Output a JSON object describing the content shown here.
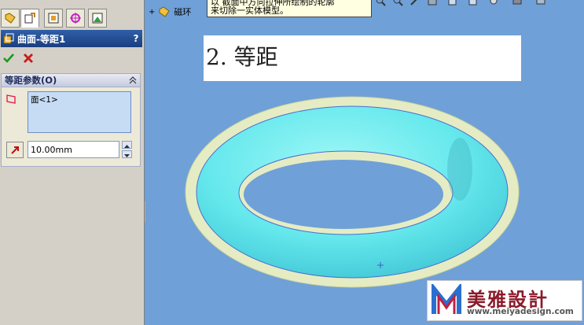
{
  "property_manager": {
    "tabs": [
      {
        "name": "feature-manager-tab",
        "icon": "feature-tree-icon"
      },
      {
        "name": "property-manager-tab",
        "icon": "property-manager-icon"
      },
      {
        "name": "configuration-manager-tab",
        "icon": "configuration-icon"
      },
      {
        "name": "dimxpert-tab",
        "icon": "crosshair-icon"
      },
      {
        "name": "display-manager-tab",
        "icon": "display-icon"
      }
    ],
    "title": "曲面-等距1",
    "help": "?",
    "group": {
      "title": "等距参数(O)",
      "face_list": [
        "面<1>"
      ],
      "offset_value": "10.00mm"
    }
  },
  "viewport": {
    "tree_node_label": "磁环",
    "tooltip_lines": [
      "以   截面中方向拉伸所绘制的轮廓",
      "来切除一实体模型。"
    ],
    "label": "2. 等距"
  },
  "watermark": {
    "brand_text": "美雅設計",
    "url": "www.meiyadesign.com"
  },
  "colors": {
    "viewport_bg": "#70a0d8",
    "torus_fill": "#5fe3e8",
    "offset_surface": "#e8efc8",
    "title_bar": "#2f5fa8"
  }
}
